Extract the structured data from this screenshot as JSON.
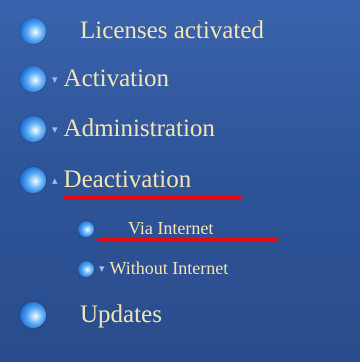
{
  "menu": {
    "items": [
      {
        "label": "Licenses activated",
        "chevron": "",
        "icon": "blue-orb-icon"
      },
      {
        "label": "Activation",
        "chevron": "▾",
        "icon": "blue-orb-icon"
      },
      {
        "label": "Administration",
        "chevron": "▾",
        "icon": "blue-orb-icon"
      },
      {
        "label": "Deactivation",
        "chevron": "▴",
        "icon": "blue-orb-icon",
        "subitems": [
          {
            "label": "Via Internet",
            "chevron": "",
            "icon": "blue-orb-icon"
          },
          {
            "label": "Without Internet",
            "chevron": "▾",
            "icon": "blue-orb-icon"
          }
        ]
      },
      {
        "label": "Updates",
        "chevron": "",
        "icon": "blue-orb-icon"
      }
    ]
  },
  "colors": {
    "background": "#2f5599",
    "label": "#f2e4b3",
    "highlight_underline": "#e50914",
    "chevron": "#8fc0ff"
  }
}
